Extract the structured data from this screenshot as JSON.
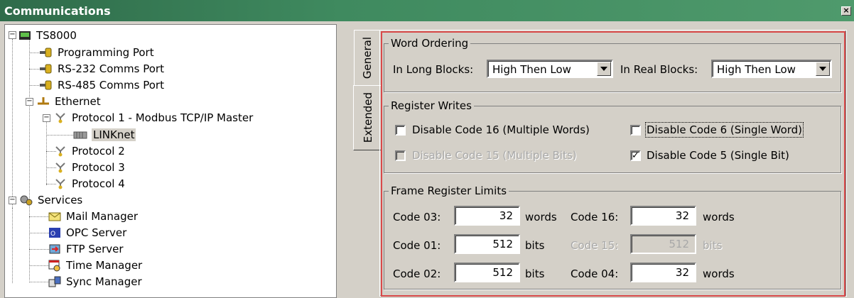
{
  "window": {
    "title": "Communications",
    "close": "×"
  },
  "tree": {
    "root": "TS8000",
    "ports": [
      "Programming Port",
      "RS-232 Comms Port",
      "RS-485 Comms Port"
    ],
    "ethernet": "Ethernet",
    "protocol1": "Protocol 1 - Modbus TCP/IP Master",
    "linknet": "LINKnet",
    "protocol2": "Protocol 2",
    "protocol3": "Protocol 3",
    "protocol4": "Protocol 4",
    "services": "Services",
    "services_items": [
      "Mail Manager",
      "OPC Server",
      "FTP Server",
      "Time Manager",
      "Sync Manager"
    ]
  },
  "tabs": {
    "general": "General",
    "extended": "Extended"
  },
  "word_ordering": {
    "legend": "Word Ordering",
    "long_label": "In Long Blocks:",
    "long_value": "High Then Low",
    "real_label": "In Real Blocks:",
    "real_value": "High Then Low"
  },
  "register_writes": {
    "legend": "Register Writes",
    "code16": "Disable Code 16 (Multiple Words)",
    "code6": "Disable Code 6 (Single Word)",
    "code15": "Disable Code 15 (Multiple Bits)",
    "code5": "Disable Code 5 (Single Bit)",
    "check_mark": "✓"
  },
  "frame_limits": {
    "legend": "Frame Register Limits",
    "rows": [
      {
        "label": "Code 03:",
        "value": "32",
        "unit": "words"
      },
      {
        "label": "Code 16:",
        "value": "32",
        "unit": "words"
      },
      {
        "label": "Code 01:",
        "value": "512",
        "unit": "bits"
      },
      {
        "label": "Code 15:",
        "value": "512",
        "unit": "bits"
      },
      {
        "label": "Code 02:",
        "value": "512",
        "unit": "bits"
      },
      {
        "label": "Code 04:",
        "value": "32",
        "unit": "words"
      }
    ]
  },
  "colors": {
    "title_bar": "#3f8a5f",
    "panel": "#d4d0c8",
    "highlight_frame": "#d94a4a"
  }
}
